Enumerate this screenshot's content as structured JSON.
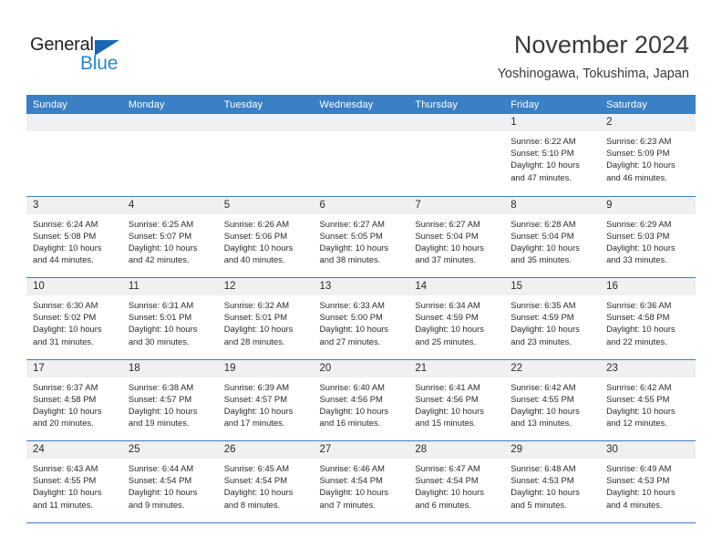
{
  "brand": {
    "name_part1": "General",
    "name_part2": "Blue",
    "triangle_color": "#1668b3",
    "blue_color": "#2a86d0"
  },
  "header": {
    "title": "November 2024",
    "subtitle": "Yoshinogawa, Tokushima, Japan"
  },
  "theme": {
    "header_blue": "#3b7fc4",
    "day_band_gray": "#f0f0f0",
    "text_color": "#2b2b2b"
  },
  "weekdays": [
    "Sunday",
    "Monday",
    "Tuesday",
    "Wednesday",
    "Thursday",
    "Friday",
    "Saturday"
  ],
  "weeks": [
    [
      {
        "day": "",
        "lines": []
      },
      {
        "day": "",
        "lines": []
      },
      {
        "day": "",
        "lines": []
      },
      {
        "day": "",
        "lines": []
      },
      {
        "day": "",
        "lines": []
      },
      {
        "day": "1",
        "lines": [
          "Sunrise: 6:22 AM",
          "Sunset: 5:10 PM",
          "Daylight: 10 hours",
          "and 47 minutes."
        ]
      },
      {
        "day": "2",
        "lines": [
          "Sunrise: 6:23 AM",
          "Sunset: 5:09 PM",
          "Daylight: 10 hours",
          "and 46 minutes."
        ]
      }
    ],
    [
      {
        "day": "3",
        "lines": [
          "Sunrise: 6:24 AM",
          "Sunset: 5:08 PM",
          "Daylight: 10 hours",
          "and 44 minutes."
        ]
      },
      {
        "day": "4",
        "lines": [
          "Sunrise: 6:25 AM",
          "Sunset: 5:07 PM",
          "Daylight: 10 hours",
          "and 42 minutes."
        ]
      },
      {
        "day": "5",
        "lines": [
          "Sunrise: 6:26 AM",
          "Sunset: 5:06 PM",
          "Daylight: 10 hours",
          "and 40 minutes."
        ]
      },
      {
        "day": "6",
        "lines": [
          "Sunrise: 6:27 AM",
          "Sunset: 5:05 PM",
          "Daylight: 10 hours",
          "and 38 minutes."
        ]
      },
      {
        "day": "7",
        "lines": [
          "Sunrise: 6:27 AM",
          "Sunset: 5:04 PM",
          "Daylight: 10 hours",
          "and 37 minutes."
        ]
      },
      {
        "day": "8",
        "lines": [
          "Sunrise: 6:28 AM",
          "Sunset: 5:04 PM",
          "Daylight: 10 hours",
          "and 35 minutes."
        ]
      },
      {
        "day": "9",
        "lines": [
          "Sunrise: 6:29 AM",
          "Sunset: 5:03 PM",
          "Daylight: 10 hours",
          "and 33 minutes."
        ]
      }
    ],
    [
      {
        "day": "10",
        "lines": [
          "Sunrise: 6:30 AM",
          "Sunset: 5:02 PM",
          "Daylight: 10 hours",
          "and 31 minutes."
        ]
      },
      {
        "day": "11",
        "lines": [
          "Sunrise: 6:31 AM",
          "Sunset: 5:01 PM",
          "Daylight: 10 hours",
          "and 30 minutes."
        ]
      },
      {
        "day": "12",
        "lines": [
          "Sunrise: 6:32 AM",
          "Sunset: 5:01 PM",
          "Daylight: 10 hours",
          "and 28 minutes."
        ]
      },
      {
        "day": "13",
        "lines": [
          "Sunrise: 6:33 AM",
          "Sunset: 5:00 PM",
          "Daylight: 10 hours",
          "and 27 minutes."
        ]
      },
      {
        "day": "14",
        "lines": [
          "Sunrise: 6:34 AM",
          "Sunset: 4:59 PM",
          "Daylight: 10 hours",
          "and 25 minutes."
        ]
      },
      {
        "day": "15",
        "lines": [
          "Sunrise: 6:35 AM",
          "Sunset: 4:59 PM",
          "Daylight: 10 hours",
          "and 23 minutes."
        ]
      },
      {
        "day": "16",
        "lines": [
          "Sunrise: 6:36 AM",
          "Sunset: 4:58 PM",
          "Daylight: 10 hours",
          "and 22 minutes."
        ]
      }
    ],
    [
      {
        "day": "17",
        "lines": [
          "Sunrise: 6:37 AM",
          "Sunset: 4:58 PM",
          "Daylight: 10 hours",
          "and 20 minutes."
        ]
      },
      {
        "day": "18",
        "lines": [
          "Sunrise: 6:38 AM",
          "Sunset: 4:57 PM",
          "Daylight: 10 hours",
          "and 19 minutes."
        ]
      },
      {
        "day": "19",
        "lines": [
          "Sunrise: 6:39 AM",
          "Sunset: 4:57 PM",
          "Daylight: 10 hours",
          "and 17 minutes."
        ]
      },
      {
        "day": "20",
        "lines": [
          "Sunrise: 6:40 AM",
          "Sunset: 4:56 PM",
          "Daylight: 10 hours",
          "and 16 minutes."
        ]
      },
      {
        "day": "21",
        "lines": [
          "Sunrise: 6:41 AM",
          "Sunset: 4:56 PM",
          "Daylight: 10 hours",
          "and 15 minutes."
        ]
      },
      {
        "day": "22",
        "lines": [
          "Sunrise: 6:42 AM",
          "Sunset: 4:55 PM",
          "Daylight: 10 hours",
          "and 13 minutes."
        ]
      },
      {
        "day": "23",
        "lines": [
          "Sunrise: 6:42 AM",
          "Sunset: 4:55 PM",
          "Daylight: 10 hours",
          "and 12 minutes."
        ]
      }
    ],
    [
      {
        "day": "24",
        "lines": [
          "Sunrise: 6:43 AM",
          "Sunset: 4:55 PM",
          "Daylight: 10 hours",
          "and 11 minutes."
        ]
      },
      {
        "day": "25",
        "lines": [
          "Sunrise: 6:44 AM",
          "Sunset: 4:54 PM",
          "Daylight: 10 hours",
          "and 9 minutes."
        ]
      },
      {
        "day": "26",
        "lines": [
          "Sunrise: 6:45 AM",
          "Sunset: 4:54 PM",
          "Daylight: 10 hours",
          "and 8 minutes."
        ]
      },
      {
        "day": "27",
        "lines": [
          "Sunrise: 6:46 AM",
          "Sunset: 4:54 PM",
          "Daylight: 10 hours",
          "and 7 minutes."
        ]
      },
      {
        "day": "28",
        "lines": [
          "Sunrise: 6:47 AM",
          "Sunset: 4:54 PM",
          "Daylight: 10 hours",
          "and 6 minutes."
        ]
      },
      {
        "day": "29",
        "lines": [
          "Sunrise: 6:48 AM",
          "Sunset: 4:53 PM",
          "Daylight: 10 hours",
          "and 5 minutes."
        ]
      },
      {
        "day": "30",
        "lines": [
          "Sunrise: 6:49 AM",
          "Sunset: 4:53 PM",
          "Daylight: 10 hours",
          "and 4 minutes."
        ]
      }
    ]
  ]
}
